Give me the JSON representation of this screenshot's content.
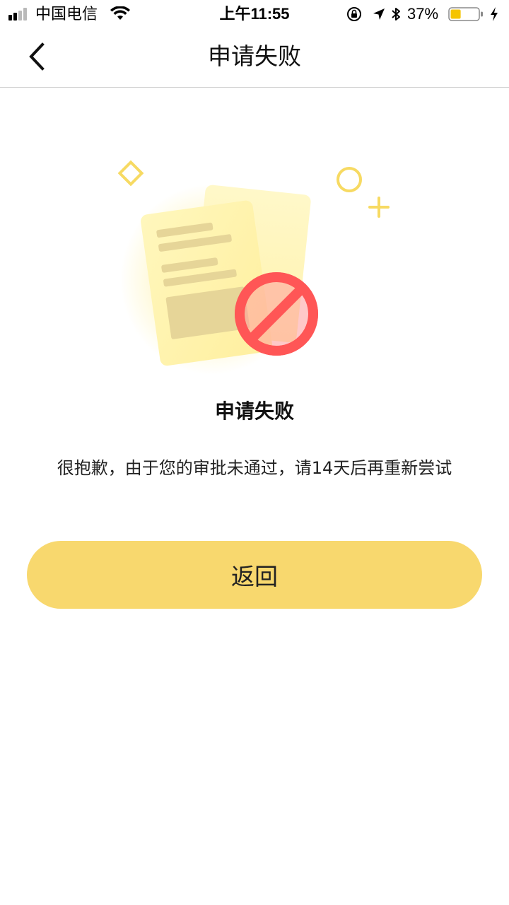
{
  "status_bar": {
    "carrier": "中国电信",
    "time": "上午11:55",
    "battery_percent": "37%",
    "battery_level": 0.37,
    "battery_color": "#f5c400",
    "icons": [
      "signal-icon",
      "wifi-icon",
      "rotation-lock-icon",
      "location-icon",
      "bluetooth-icon",
      "battery-icon",
      "charging-icon"
    ]
  },
  "nav": {
    "back_icon": "chevron-left-icon",
    "title": "申请失败"
  },
  "illustration": {
    "icon": "application-rejected-icon",
    "colors": {
      "paper": "#fff5b8",
      "lines": "#e8d9a0",
      "prohibited": "#ff5d5d",
      "decor": "#f7da62"
    }
  },
  "result": {
    "title": "申请失败",
    "message": "很抱歉，由于您的审批未通过，请14天后再重新尝试"
  },
  "actions": {
    "return_label": "返回",
    "accent_color": "#f8d86e"
  }
}
